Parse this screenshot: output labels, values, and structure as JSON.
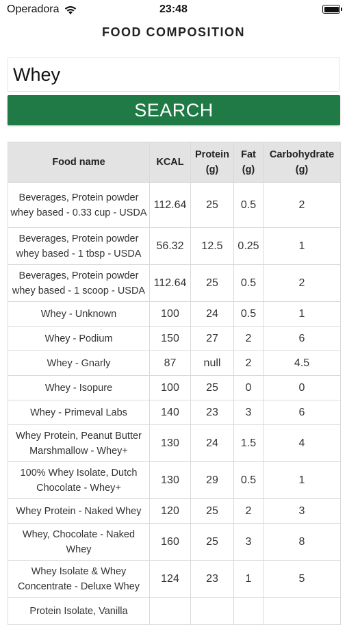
{
  "status_bar": {
    "carrier": "Operadora",
    "time": "23:48"
  },
  "header": {
    "title": "FOOD COMPOSITION"
  },
  "search": {
    "value": "Whey",
    "button_label": "SEARCH"
  },
  "colors": {
    "accent": "#1f7a45",
    "table_header_bg": "#e3e3e3"
  },
  "table": {
    "headers": [
      "Food name",
      "KCAL",
      "Protein (g)",
      "Fat (g)",
      "Carbohydrate (g)"
    ],
    "rows": [
      [
        "Beverages, Protein powder whey based - 0.33 cup - USDA",
        "112.64",
        "25",
        "0.5",
        "2"
      ],
      [
        "Beverages, Protein powder whey based - 1 tbsp - USDA",
        "56.32",
        "12.5",
        "0.25",
        "1"
      ],
      [
        "Beverages, Protein powder whey based - 1 scoop - USDA",
        "112.64",
        "25",
        "0.5",
        "2"
      ],
      [
        "Whey - Unknown",
        "100",
        "24",
        "0.5",
        "1"
      ],
      [
        "Whey - Podium",
        "150",
        "27",
        "2",
        "6"
      ],
      [
        "Whey - Gnarly",
        "87",
        "null",
        "2",
        "4.5"
      ],
      [
        "Whey - Isopure",
        "100",
        "25",
        "0",
        "0"
      ],
      [
        "Whey - Primeval Labs",
        "140",
        "23",
        "3",
        "6"
      ],
      [
        "Whey Protein, Peanut Butter Marshmallow - Whey+",
        "130",
        "24",
        "1.5",
        "4"
      ],
      [
        "100% Whey Isolate, Dutch Chocolate - Whey+",
        "130",
        "29",
        "0.5",
        "1"
      ],
      [
        "Whey Protein - Naked Whey",
        "120",
        "25",
        "2",
        "3"
      ],
      [
        "Whey, Chocolate - Naked Whey",
        "160",
        "25",
        "3",
        "8"
      ],
      [
        "Whey Isolate & Whey Concentrate - Deluxe Whey",
        "124",
        "23",
        "1",
        "5"
      ],
      [
        "Protein Isolate, Vanilla",
        "",
        "",
        "",
        ""
      ]
    ]
  }
}
